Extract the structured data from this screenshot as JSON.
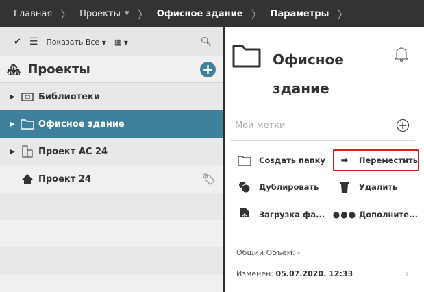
{
  "breadcrumb": [
    "Главная",
    "Проекты",
    "Офисное здание",
    "Параметры"
  ],
  "toolbar": {
    "filter_label": "Показать Все"
  },
  "projects": {
    "title": "Проекты",
    "items": [
      {
        "label": "Библиотеки",
        "icon": "library-folder-icon",
        "expandable": true
      },
      {
        "label": "Офисное здание",
        "icon": "folder-icon",
        "expandable": true,
        "selected": true
      },
      {
        "label": "Проект АС 24",
        "icon": "building-icon",
        "expandable": true
      },
      {
        "label": "Проект 24",
        "icon": "house-icon",
        "expandable": false,
        "tag": true
      }
    ]
  },
  "details": {
    "title": "Офисное здание",
    "tags_placeholder": "Мои метки",
    "actions": {
      "create_folder": "Создать папку",
      "move": "Переместить",
      "duplicate": "Дублировать",
      "delete": "Удалить",
      "upload": "Загрузка фа...",
      "more": "Дополните..."
    },
    "size_label": "Общий Объем:",
    "size_value": "-",
    "modified_label": "Изменен:",
    "modified_value": "05.07.2020. 12:33"
  },
  "colors": {
    "selected": "#3f819c",
    "highlight": "#e02020"
  }
}
